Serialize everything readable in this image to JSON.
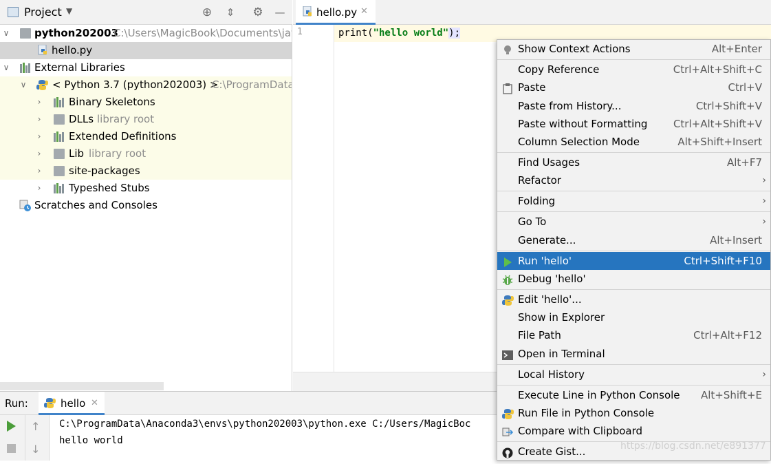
{
  "project_panel": {
    "title": "Project",
    "tree": [
      {
        "label": "python202003",
        "detail": "C:\\Users\\MagicBook\\Documents\\jav",
        "icon": "folder-icon",
        "arrow": "expanded"
      },
      {
        "label": "hello.py",
        "detail": "",
        "icon": "python-file-icon",
        "arrow": "none",
        "selected": true
      },
      {
        "label": "External Libraries",
        "detail": "",
        "icon": "library-icon",
        "arrow": "expanded"
      },
      {
        "label": "< Python 3.7 (python202003) >",
        "detail": "C:\\ProgramData",
        "icon": "python-sdk-icon",
        "arrow": "expanded"
      },
      {
        "label": "Binary Skeletons",
        "detail": "",
        "icon": "library-icon",
        "arrow": "collapsed"
      },
      {
        "label": "DLLs",
        "detail": "library root",
        "icon": "folder-icon",
        "arrow": "collapsed"
      },
      {
        "label": "Extended Definitions",
        "detail": "",
        "icon": "library-icon",
        "arrow": "collapsed"
      },
      {
        "label": "Lib",
        "detail": "library root",
        "icon": "folder-icon",
        "arrow": "collapsed"
      },
      {
        "label": "site-packages",
        "detail": "",
        "icon": "folder-icon",
        "arrow": "collapsed"
      },
      {
        "label": "Typeshed Stubs",
        "detail": "",
        "icon": "library-icon",
        "arrow": "collapsed"
      },
      {
        "label": "Scratches and Consoles",
        "detail": "",
        "icon": "scratches-icon",
        "arrow": "none"
      }
    ]
  },
  "editor": {
    "tab_label": "hello.py",
    "line_number": "1",
    "code_fn": "print(",
    "code_str": "\"hello world\"",
    "code_end": ");"
  },
  "run_panel": {
    "label": "Run:",
    "tab_label": "hello",
    "output": [
      "C:\\ProgramData\\Anaconda3\\envs\\python202003\\python.exe C:/Users/MagicBoc",
      "hello world"
    ]
  },
  "context_menu": {
    "items": [
      {
        "label": "Show Context Actions",
        "shortcut": "Alt+Enter",
        "icon": "bulb-icon"
      },
      {
        "label": "Copy Reference",
        "shortcut": "Ctrl+Alt+Shift+C"
      },
      {
        "label": "Paste",
        "shortcut": "Ctrl+V",
        "icon": "clipboard-icon"
      },
      {
        "label": "Paste from History...",
        "shortcut": "Ctrl+Shift+V"
      },
      {
        "label": "Paste without Formatting",
        "shortcut": "Ctrl+Alt+Shift+V"
      },
      {
        "label": "Column Selection Mode",
        "shortcut": "Alt+Shift+Insert"
      },
      {
        "label": "Find Usages",
        "shortcut": "Alt+F7"
      },
      {
        "label": "Refactor",
        "shortcut": ""
      },
      {
        "label": "Folding",
        "shortcut": ""
      },
      {
        "label": "Go To",
        "shortcut": ""
      },
      {
        "label": "Generate...",
        "shortcut": "Alt+Insert"
      },
      {
        "label": "Run 'hello'",
        "shortcut": "Ctrl+Shift+F10",
        "icon": "run-icon",
        "selected": true
      },
      {
        "label": "Debug 'hello'",
        "shortcut": "",
        "icon": "debug-icon"
      },
      {
        "label": "Edit 'hello'...",
        "shortcut": "",
        "icon": "python-icon"
      },
      {
        "label": "Show in Explorer",
        "shortcut": ""
      },
      {
        "label": "File Path",
        "shortcut": "Ctrl+Alt+F12"
      },
      {
        "label": "Open in Terminal",
        "shortcut": "",
        "icon": "terminal-icon"
      },
      {
        "label": "Local History",
        "shortcut": ""
      },
      {
        "label": "Execute Line in Python Console",
        "shortcut": "Alt+Shift+E"
      },
      {
        "label": "Run File in Python Console",
        "shortcut": "",
        "icon": "python-icon"
      },
      {
        "label": "Compare with Clipboard",
        "shortcut": "",
        "icon": "compare-icon"
      },
      {
        "label": "Create Gist...",
        "shortcut": "",
        "icon": "github-icon"
      }
    ]
  },
  "watermark": "https://blog.csdn.net/e891377",
  "colors": {
    "selection": "#2675bf",
    "string": "#067d17",
    "caret_line": "#fffae3",
    "sdk_highlight": "#fcfce8"
  }
}
